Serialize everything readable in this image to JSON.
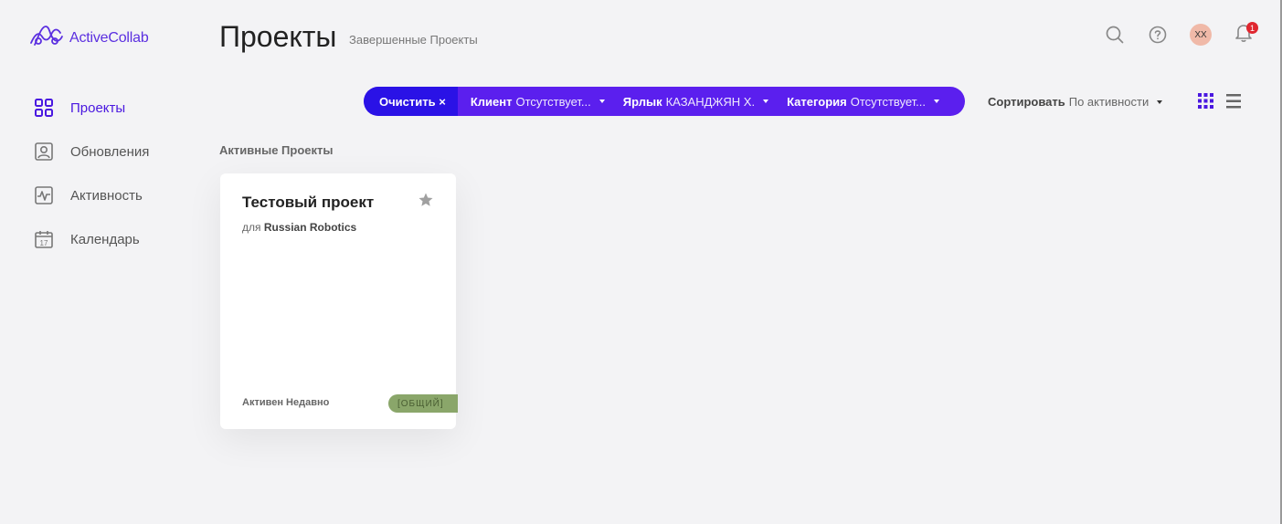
{
  "app": {
    "name": "ActiveCollab"
  },
  "sidebar": {
    "items": [
      {
        "label": "Проекты",
        "icon": "grid-icon"
      },
      {
        "label": "Обновления",
        "icon": "updates-icon"
      },
      {
        "label": "Активность",
        "icon": "activity-icon"
      },
      {
        "label": "Календарь",
        "icon": "calendar-icon",
        "day": "17"
      }
    ]
  },
  "header": {
    "title": "Проекты",
    "subtitle": "Завершенные Проекты"
  },
  "topbar": {
    "avatar_initials": "XX",
    "notifications_count": "1"
  },
  "filters": {
    "clear_label": "Очистить ×",
    "items": [
      {
        "name": "Клиент",
        "value": "Отсутствует..."
      },
      {
        "name": "Ярлык",
        "value": "КАЗАНДЖЯН Х."
      },
      {
        "name": "Категория",
        "value": "Отсутствует..."
      }
    ]
  },
  "sort": {
    "label": "Сортировать",
    "value": "По активности"
  },
  "section": {
    "label": "Активные Проекты"
  },
  "project_card": {
    "title": "Тестовый проект",
    "client_prefix": "для",
    "client": "Russian Robotics",
    "status": "Активен Недавно",
    "tag": "[ОБЩИЙ]"
  },
  "colors": {
    "accent": "#5b1fee",
    "accent_dark": "#2a12e6",
    "tag": "#8aa66a",
    "badge": "#e0262f"
  }
}
